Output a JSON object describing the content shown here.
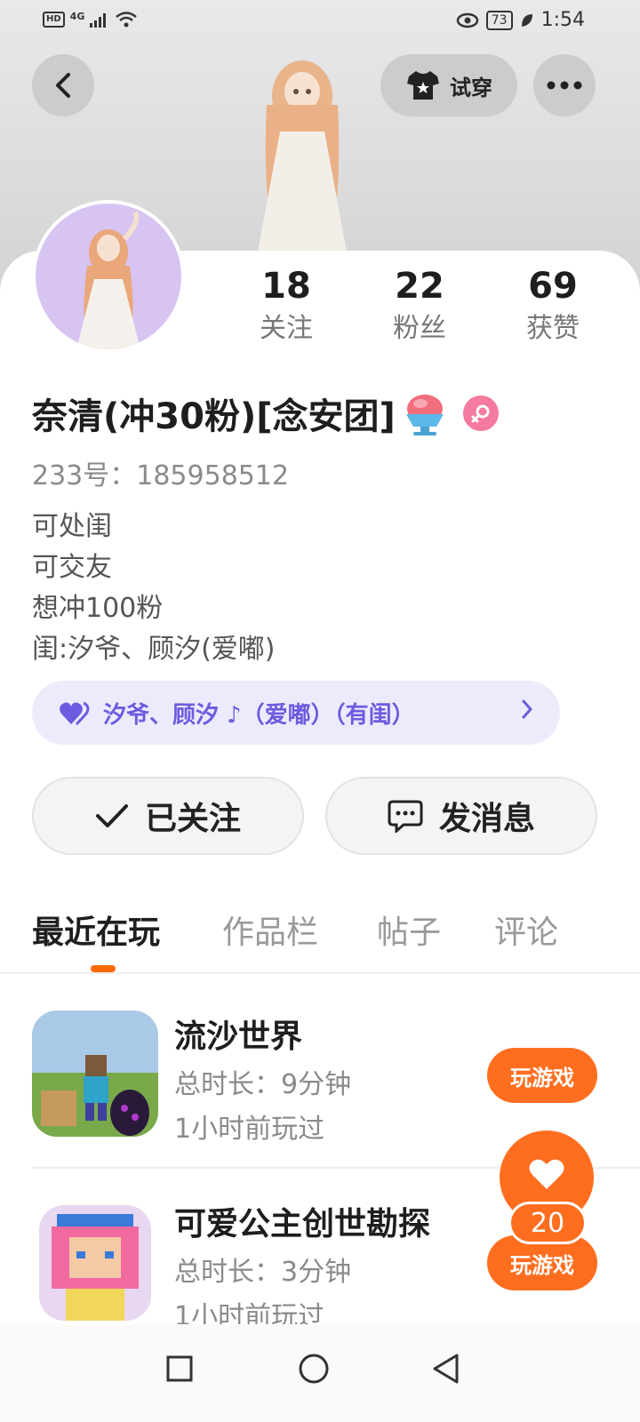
{
  "status_bar": {
    "network_badge": "HD",
    "network_type": "4G",
    "battery": "73",
    "time": "1:54"
  },
  "header": {
    "try_on_label": "试穿"
  },
  "stats": [
    {
      "value": "18",
      "label": "关注"
    },
    {
      "value": "22",
      "label": "粉丝"
    },
    {
      "value": "69",
      "label": "获赞"
    }
  ],
  "profile": {
    "username": "奈清(冲30粉)[念安团]",
    "uid": "233号：185958512",
    "bio": [
      "可处闺",
      "可交友",
      "想冲100粉",
      "闺:汐爷、顾汐(爱嘟)"
    ],
    "group_tag": "汐爷、顾汐 ♪（爱嘟）（有闺）"
  },
  "actions": {
    "follow_label": "已关注",
    "message_label": "发消息"
  },
  "tabs": [
    "最近在玩",
    "作品栏",
    "帖子",
    "评论"
  ],
  "games": [
    {
      "name": "流沙世界",
      "duration": "总时长：9分钟",
      "last_played": "1小时前玩过",
      "button": "玩游戏"
    },
    {
      "name": "可爱公主创世勘探",
      "duration": "总时长：3分钟",
      "last_played": "1小时前玩过",
      "button": "玩游戏"
    }
  ],
  "like_fab": {
    "count": "20"
  },
  "colors": {
    "accent": "#ff6e1f",
    "group_pill_bg": "#ecebfb",
    "group_pill_text": "#6b5ce0",
    "gender_badge": "#f47a9e"
  },
  "icons": [
    "back-arrow-icon",
    "tshirt-icon",
    "more-dots-icon",
    "eye-icon",
    "leaf-icon",
    "signal-icon",
    "wifi-icon",
    "shaved-ice-emoji-icon",
    "female-icon",
    "heart-icon",
    "check-icon",
    "chat-bubble-icon",
    "chevron-right-icon",
    "square-nav-icon",
    "circle-nav-icon",
    "triangle-back-nav-icon"
  ]
}
